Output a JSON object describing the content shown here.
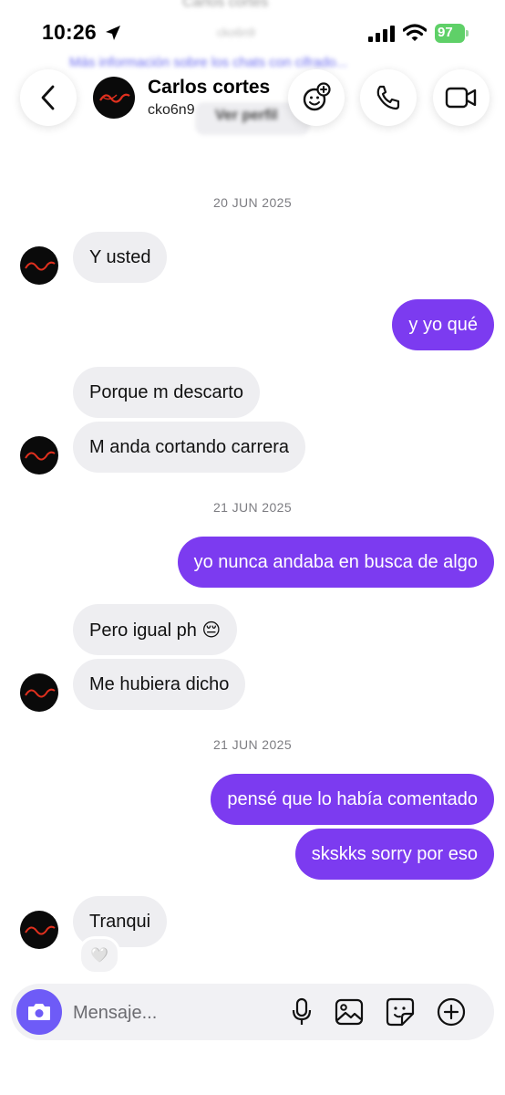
{
  "status_bar": {
    "time": "10:26",
    "battery": "97"
  },
  "background": {
    "info_link": "Más información sobre los chats con cifrado...",
    "view_profile": "Ver perfil"
  },
  "header": {
    "name": "Carlos cortes",
    "username": "cko6n9",
    "icons": [
      "back-icon",
      "effects-icon",
      "phone-icon",
      "video-icon"
    ]
  },
  "chat": {
    "date1": "20 JUN 2025",
    "date2": "21 JUN 2025",
    "date3": "21 JUN 2025",
    "messages": [
      {
        "from": "them",
        "text": "Y usted"
      },
      {
        "from": "me",
        "text": "y yo qué"
      },
      {
        "from": "them",
        "text": "Porque m descarto"
      },
      {
        "from": "them",
        "text": "M anda cortando carrera"
      },
      {
        "from": "me",
        "text": "yo nunca andaba en busca de algo"
      },
      {
        "from": "them",
        "text": "Pero igual ph 😔"
      },
      {
        "from": "them",
        "text": "Me hubiera dicho"
      },
      {
        "from": "me",
        "text": "pensé que lo había comentado"
      },
      {
        "from": "me",
        "text": "skskks sorry por eso"
      },
      {
        "from": "them",
        "text": "Tranqui",
        "reaction": "🤍"
      }
    ]
  },
  "composer": {
    "placeholder": "Mensaje..."
  },
  "colors": {
    "accent": "#7c3bf0",
    "incoming": "#eeeef1",
    "camera": "#6e5bf7"
  }
}
